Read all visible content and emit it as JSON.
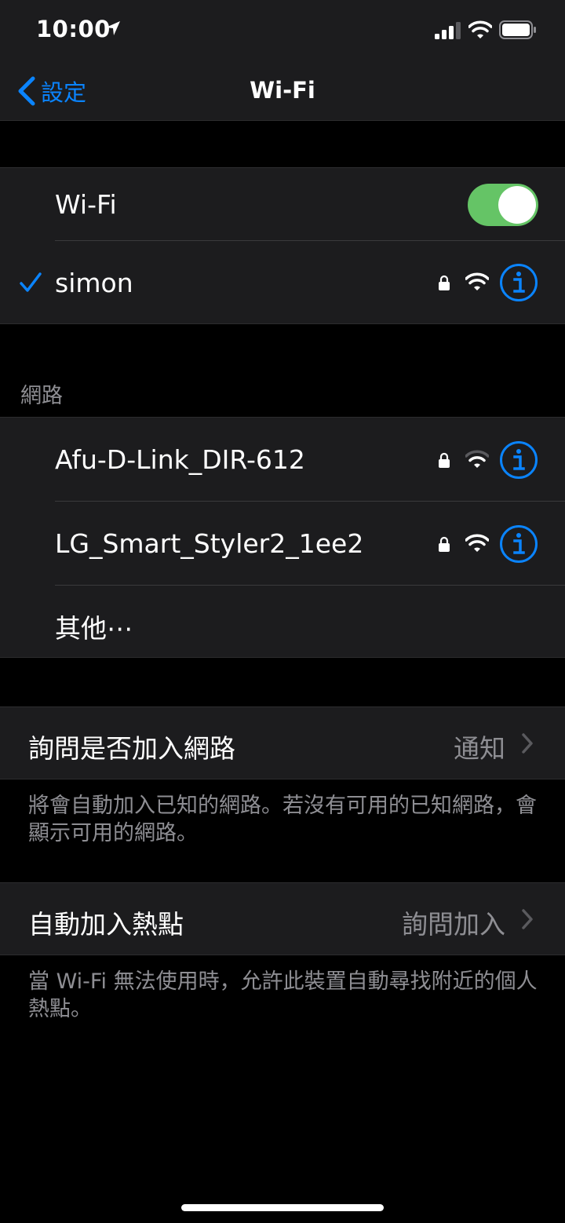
{
  "status": {
    "time": "10:00"
  },
  "nav": {
    "back_label": "設定",
    "title": "Wi-Fi"
  },
  "wifi_toggle": {
    "label": "Wi-Fi",
    "on": true
  },
  "connected": {
    "name": "simon"
  },
  "networks_header": "網路",
  "networks": [
    {
      "name": "Afu-D-Link_DIR-612"
    },
    {
      "name": "LG_Smart_Styler2_1ee2"
    },
    {
      "name": "其他⋯"
    }
  ],
  "ask_join": {
    "label": "詢問是否加入網路",
    "value": "通知",
    "footer": "將會自動加入已知的網路。若沒有可用的已知網路，會顯示可用的網路。"
  },
  "auto_hotspot": {
    "label": "自動加入熱點",
    "value": "詢問加入",
    "footer": "當 Wi-Fi 無法使用時，允許此裝置自動尋找附近的個人熱點。"
  },
  "colors": {
    "accent": "#0a84ff",
    "toggle_on": "#65c466",
    "cell_bg": "#1c1c1e",
    "secondary_text": "#8e8e93"
  }
}
